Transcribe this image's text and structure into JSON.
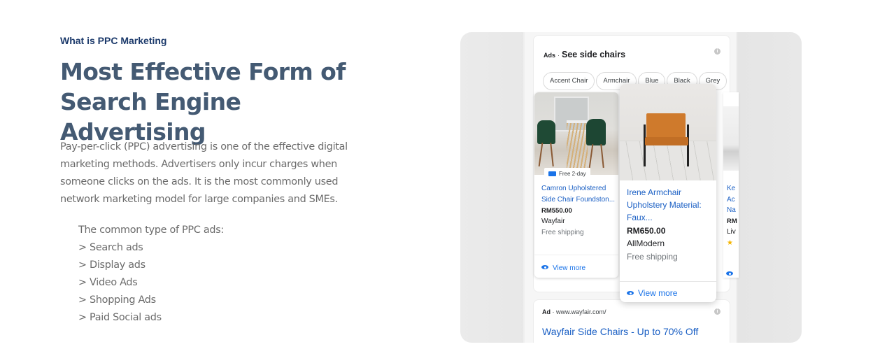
{
  "section": {
    "eyebrow": "What is PPC Marketing",
    "title": "Most Effective Form of Search Engine Advertising",
    "intro": "Pay-per-click (PPC) advertising is one of the effective digital marketing methods. Advertisers only incur charges when someone clicks on the ads. It is the most commonly used network marketing model for large companies and SMEs.",
    "types_heading": "The common type of PPC ads:",
    "types": [
      "> Search ads",
      "> Display ads",
      "> Video Ads",
      "> Shopping Ads",
      "> Paid Social ads"
    ]
  },
  "mockup": {
    "ads_label": "Ads",
    "ads_separator": "·",
    "ads_title": "See side chairs",
    "info_icon": "i",
    "chips": [
      "Accent Chair",
      "Armchair",
      "Blue",
      "Black",
      "Grey"
    ],
    "products": [
      {
        "badge": "Free 2-day",
        "title": "Camron Upholstered Side Chair Foundston...",
        "price": "RM550.00",
        "store": "Wayfair",
        "shipping": "Free shipping",
        "cta": "View more"
      },
      {
        "title": "Irene Armchair Upholstery Material: Faux...",
        "price": "RM650.00",
        "store": "AllModern",
        "shipping": "Free shipping",
        "cta": "View more"
      },
      {
        "title_lines": [
          "Ke",
          "Ac",
          "Na"
        ],
        "price": "RM",
        "store": "Liv",
        "rating_glyph": "★"
      }
    ],
    "text_ad": {
      "label": "Ad",
      "separator": "·",
      "url": "www.wayfair.com/",
      "title": "Wayfair Side Chairs - Up to 70% Off"
    }
  }
}
